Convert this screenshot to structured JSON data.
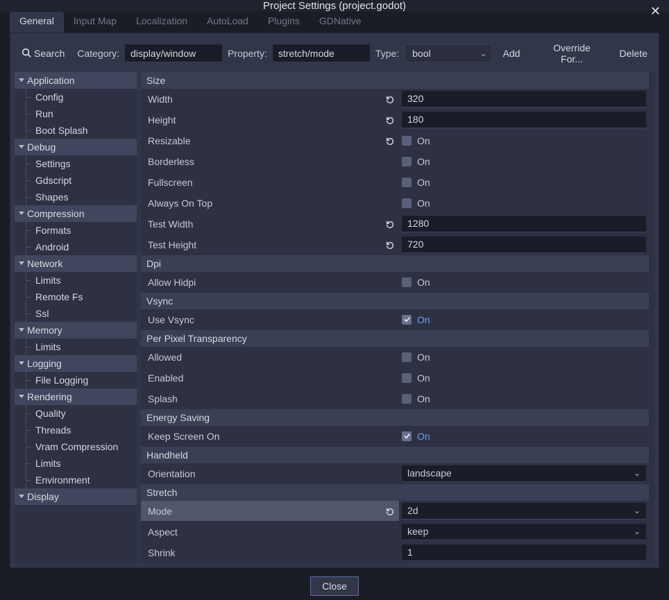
{
  "window": {
    "title": "Project Settings (project.godot)",
    "close_label": "Close"
  },
  "tabs": [
    {
      "label": "General"
    },
    {
      "label": "Input Map"
    },
    {
      "label": "Localization"
    },
    {
      "label": "AutoLoad"
    },
    {
      "label": "Plugins"
    },
    {
      "label": "GDNative"
    }
  ],
  "active_tab_index": 0,
  "toolbar": {
    "search_label": "Search",
    "category_label": "Category:",
    "category_value": "display/window",
    "property_label": "Property:",
    "property_value": "stretch/mode",
    "type_label": "Type:",
    "type_value": "bool",
    "add_label": "Add",
    "override_label": "Override For...",
    "delete_label": "Delete"
  },
  "sidebar": [
    {
      "label": "Application",
      "children": [
        "Config",
        "Run",
        "Boot Splash"
      ]
    },
    {
      "label": "Debug",
      "children": [
        "Settings",
        "Gdscript",
        "Shapes"
      ]
    },
    {
      "label": "Compression",
      "children": [
        "Formats",
        "Android"
      ]
    },
    {
      "label": "Network",
      "children": [
        "Limits",
        "Remote Fs",
        "Ssl"
      ]
    },
    {
      "label": "Memory",
      "children": [
        "Limits"
      ]
    },
    {
      "label": "Logging",
      "children": [
        "File Logging"
      ]
    },
    {
      "label": "Rendering",
      "children": [
        "Quality",
        "Threads",
        "Vram Compression",
        "Limits",
        "Environment"
      ]
    },
    {
      "label": "Display",
      "children": []
    }
  ],
  "sections": [
    {
      "title": "Size",
      "props": [
        {
          "label": "Width",
          "kind": "number",
          "value": "320",
          "revert": true
        },
        {
          "label": "Height",
          "kind": "number",
          "value": "180",
          "revert": true
        },
        {
          "label": "Resizable",
          "kind": "check",
          "on": false,
          "text": "On",
          "revert": true
        },
        {
          "label": "Borderless",
          "kind": "check",
          "on": false,
          "text": "On",
          "revert": false
        },
        {
          "label": "Fullscreen",
          "kind": "check",
          "on": false,
          "text": "On",
          "revert": false
        },
        {
          "label": "Always On Top",
          "kind": "check",
          "on": false,
          "text": "On",
          "revert": false
        },
        {
          "label": "Test Width",
          "kind": "number",
          "value": "1280",
          "revert": true
        },
        {
          "label": "Test Height",
          "kind": "number",
          "value": "720",
          "revert": true
        }
      ]
    },
    {
      "title": "Dpi",
      "props": [
        {
          "label": "Allow Hidpi",
          "kind": "check",
          "on": false,
          "text": "On",
          "revert": false
        }
      ]
    },
    {
      "title": "Vsync",
      "props": [
        {
          "label": "Use Vsync",
          "kind": "check",
          "on": true,
          "text": "On",
          "accent": true,
          "revert": false
        }
      ]
    },
    {
      "title": "Per Pixel Transparency",
      "props": [
        {
          "label": "Allowed",
          "kind": "check",
          "on": false,
          "text": "On",
          "revert": false
        },
        {
          "label": "Enabled",
          "kind": "check",
          "on": false,
          "text": "On",
          "revert": false
        },
        {
          "label": "Splash",
          "kind": "check",
          "on": false,
          "text": "On",
          "revert": false
        }
      ]
    },
    {
      "title": "Energy Saving",
      "props": [
        {
          "label": "Keep Screen On",
          "kind": "check",
          "on": true,
          "text": "On",
          "accent": true,
          "revert": false
        }
      ]
    },
    {
      "title": "Handheld",
      "props": [
        {
          "label": "Orientation",
          "kind": "dropdown",
          "value": "landscape",
          "revert": false
        }
      ]
    },
    {
      "title": "Stretch",
      "props": [
        {
          "label": "Mode",
          "kind": "dropdown",
          "value": "2d",
          "revert": true,
          "highlight": true
        },
        {
          "label": "Aspect",
          "kind": "dropdown",
          "value": "keep",
          "revert": false
        },
        {
          "label": "Shrink",
          "kind": "number",
          "value": "1",
          "revert": false
        }
      ]
    }
  ]
}
